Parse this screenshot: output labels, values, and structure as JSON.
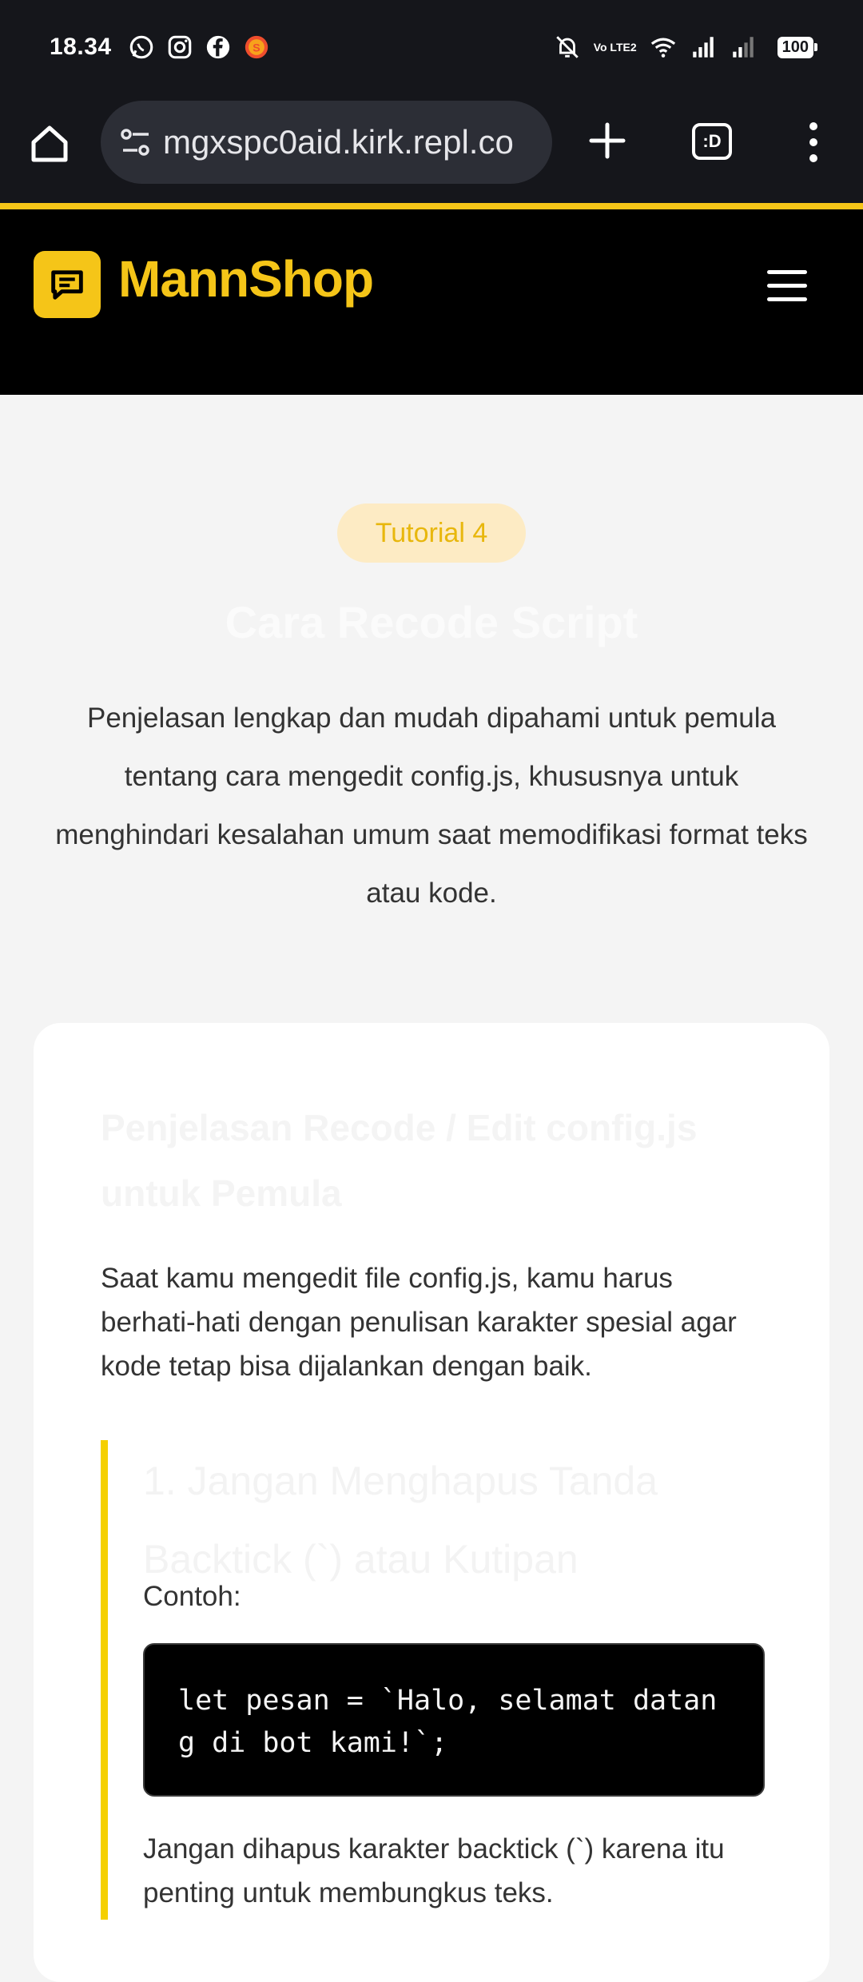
{
  "status_bar": {
    "time": "18.34",
    "volte": "Vo LTE2",
    "battery": "100",
    "icons": [
      "whatsapp-icon",
      "instagram-icon",
      "facebook-icon",
      "shopee-icon",
      "mute-bell-icon",
      "wifi-icon",
      "signal-icon",
      "signal-icon-2"
    ]
  },
  "browser": {
    "url": "mgxspc0aid.kirk.repl.co",
    "tabs_label": ":D"
  },
  "site": {
    "brand": "MannShop",
    "accent_color": "#f5c518"
  },
  "hero": {
    "badge": "Tutorial 4",
    "title": "Cara Recode Script",
    "description": "Penjelasan lengkap dan mudah dipahami untuk pemula tentang cara mengedit config.js, khususnya untuk menghindari kesalahan umum saat memodifikasi format teks atau kode."
  },
  "card": {
    "title": "Penjelasan Recode / Edit config.js untuk Pemula",
    "intro": "Saat kamu mengedit file config.js, kamu harus berhati-hati dengan penulisan karakter spesial agar kode tetap bisa dijalankan dengan baik.",
    "tip": {
      "title": "1. Jangan Menghapus Tanda Backtick (`) atau Kutipan",
      "label": "Contoh:",
      "code": "let pesan = `Halo, selamat datang di bot kami!`;",
      "note": "Jangan dihapus karakter backtick (`) karena itu penting untuk membungkus teks."
    }
  }
}
